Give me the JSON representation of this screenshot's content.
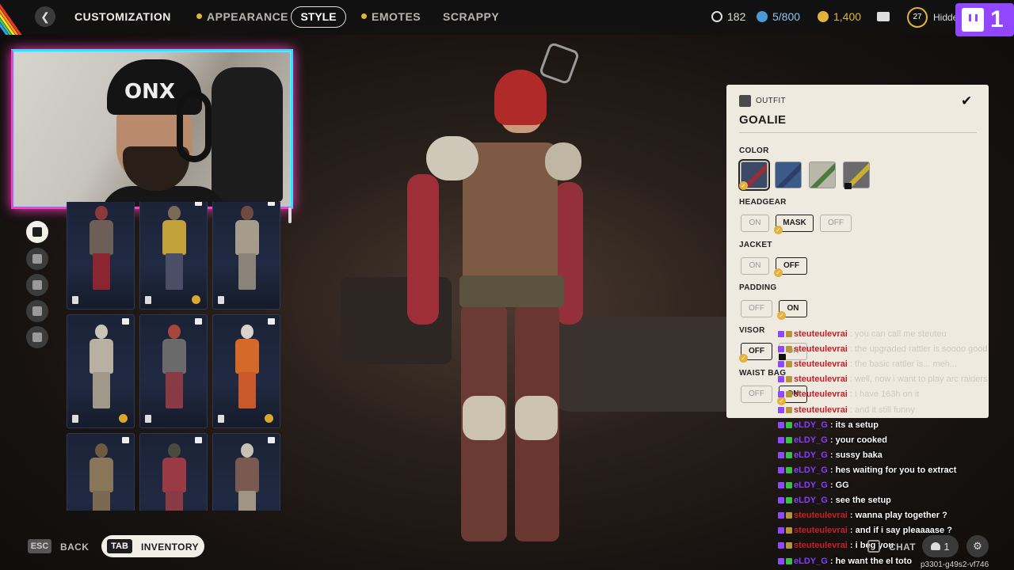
{
  "topbar": {
    "title": "CUSTOMIZATION",
    "tabs": [
      {
        "label": "APPEARANCE",
        "dot": true
      },
      {
        "label": "STYLE",
        "active": true
      },
      {
        "label": "EMOTES",
        "dot": true
      },
      {
        "label": "SCRAPPY"
      }
    ],
    "resources": {
      "raider_tokens": "182",
      "capacity": "5/800",
      "coins": "1,400"
    },
    "player_level": "27",
    "player_status": "Hidden",
    "twitch_count": "1",
    "accent_color": "#e3b23c"
  },
  "sidebar": {
    "icons": [
      "outfit-icon",
      "backpack-icon",
      "inventory-icon",
      "emote-icon",
      "pickaxe-icon"
    ]
  },
  "outfit_grid": {
    "cards": [
      {
        "locked": false,
        "coin": false,
        "colors": [
          "#8a3a3a",
          "#6d5f58",
          "#8b2530"
        ]
      },
      {
        "locked": true,
        "coin": true,
        "colors": [
          "#7a6a56",
          "#c2a03a",
          "#4a4e66"
        ]
      },
      {
        "locked": true,
        "coin": false,
        "colors": [
          "#6e4a40",
          "#a69c8c",
          "#8a8478"
        ]
      },
      {
        "locked": true,
        "coin": true,
        "colors": [
          "#c9c4b8",
          "#b8b0a2",
          "#a09888"
        ]
      },
      {
        "locked": true,
        "coin": false,
        "colors": [
          "#a6473c",
          "#6a6a6a",
          "#8a3a44"
        ]
      },
      {
        "locked": true,
        "coin": true,
        "colors": [
          "#d8d4cc",
          "#d46a2a",
          "#c9582a"
        ]
      },
      {
        "locked": true,
        "coin": false,
        "colors": [
          "#6e5a40",
          "#8a7658",
          "#7a6850"
        ]
      },
      {
        "locked": true,
        "coin": false,
        "colors": [
          "#4a4a3e",
          "#9a3a44",
          "#8a3a44"
        ]
      },
      {
        "locked": true,
        "coin": false,
        "colors": [
          "#c8c2b6",
          "#7a5a50",
          "#a09486"
        ]
      }
    ]
  },
  "outfit_panel": {
    "section_label": "OUTFIT",
    "name": "GOALIE",
    "color_label": "COLOR",
    "color_swatches": [
      {
        "bg": "#3b4a66",
        "stripe": "#9a2e36",
        "selected": true
      },
      {
        "bg": "#3b5a8a",
        "stripe": "#2d3f66",
        "selected": false
      },
      {
        "bg": "#b9b7aa",
        "stripe": "#4a7a3a",
        "selected": false
      },
      {
        "bg": "#6a6a6a",
        "stripe": "#c9b030",
        "selected": false,
        "locked": true
      }
    ],
    "headgear": {
      "label": "HEADGEAR",
      "options": [
        "ON",
        "MASK",
        "OFF"
      ],
      "selected": "MASK"
    },
    "jacket": {
      "label": "JACKET",
      "options": [
        "ON",
        "OFF"
      ],
      "selected": "OFF"
    },
    "padding": {
      "label": "PADDING",
      "options": [
        "OFF",
        "ON"
      ],
      "selected": "ON"
    },
    "visor": {
      "label": "VISOR",
      "options": [
        "OFF",
        "ON"
      ],
      "selected": "OFF"
    },
    "waist_bag": {
      "label": "WAIST BAG",
      "options": [
        "OFF",
        "ON"
      ],
      "selected": "ON"
    }
  },
  "chat": {
    "messages": [
      {
        "user": "steuteulevrai",
        "text": "you can call me steuteu",
        "user_color": "#c81e28",
        "faded": true
      },
      {
        "user": "steuteulevrai",
        "text": "the upgraded rattler is soooo good",
        "user_color": "#c81e28",
        "faded": true
      },
      {
        "user": "steuteulevrai",
        "text": "the basic rattler is... meh...",
        "user_color": "#c81e28",
        "faded": true
      },
      {
        "user": "steuteulevrai",
        "text": "well, now i want to play arc raiders",
        "user_color": "#c81e28",
        "faded": true
      },
      {
        "user": "steuteulevrai",
        "text": "I have 163h on it",
        "user_color": "#c81e28",
        "faded": true
      },
      {
        "user": "steuteulevrai",
        "text": "and it still funny",
        "user_color": "#c81e28",
        "faded": true
      },
      {
        "user": "eLDY_G",
        "text": "its a setup",
        "user_color": "#8a3aff",
        "faded": false
      },
      {
        "user": "eLDY_G",
        "text": "your cooked",
        "user_color": "#8a3aff",
        "faded": false
      },
      {
        "user": "eLDY_G",
        "text": "sussy baka",
        "user_color": "#8a3aff",
        "faded": false
      },
      {
        "user": "eLDY_G",
        "text": "hes waiting for you to extract",
        "user_color": "#8a3aff",
        "faded": false
      },
      {
        "user": "eLDY_G",
        "text": "GG",
        "user_color": "#8a3aff",
        "faded": false
      },
      {
        "user": "eLDY_G",
        "text": "see the setup",
        "user_color": "#8a3aff",
        "faded": false
      },
      {
        "user": "steuteulevrai",
        "text": "wanna play together ?",
        "user_color": "#c81e28",
        "faded": false
      },
      {
        "user": "steuteulevrai",
        "text": "and if i say pleaaaase ?",
        "user_color": "#c81e28",
        "faded": false
      },
      {
        "user": "steuteulevrai",
        "text": "i beg you",
        "user_color": "#c81e28",
        "faded": false
      },
      {
        "user": "eLDY_G",
        "text": "he want the el toto",
        "user_color": "#8a3aff",
        "faded": false
      }
    ]
  },
  "bottombar": {
    "back_key": "ESC",
    "back_label": "BACK",
    "inventory_key": "TAB",
    "inventory_label": "INVENTORY",
    "chat_label": "CHAT",
    "party_count": "1",
    "build_id": "p3301-g49s2-vf746"
  }
}
